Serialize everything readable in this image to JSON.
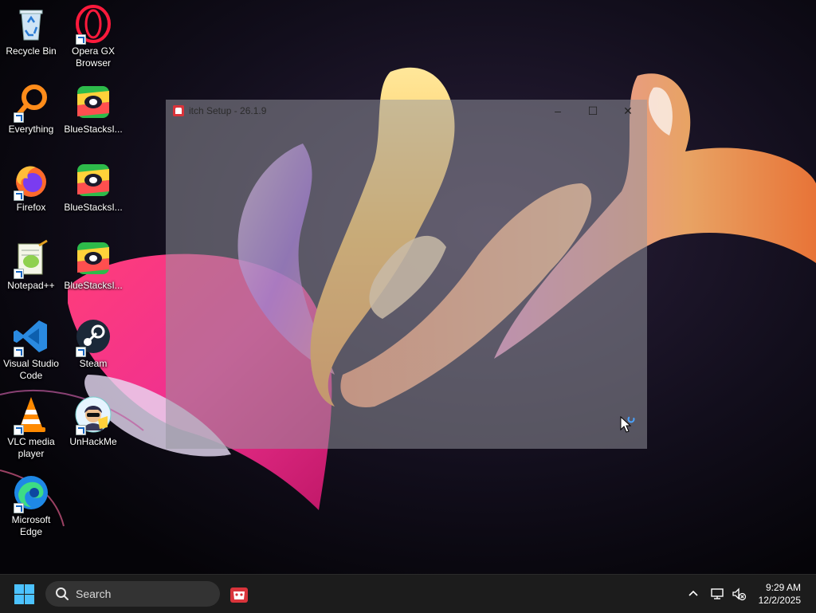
{
  "desktop": {
    "icons": [
      {
        "label": "Recycle Bin",
        "icon": "recycle-bin-icon"
      },
      {
        "label": "Opera GX Browser",
        "icon": "opera-gx-icon"
      },
      {
        "label": "Everything",
        "icon": "everything-search-icon"
      },
      {
        "label": "BlueStacksI...",
        "icon": "bluestacks-icon"
      },
      {
        "label": "Firefox",
        "icon": "firefox-icon"
      },
      {
        "label": "BlueStacksI...",
        "icon": "bluestacks-icon"
      },
      {
        "label": "Notepad++",
        "icon": "notepadpp-icon"
      },
      {
        "label": "BlueStacksI...",
        "icon": "bluestacks-icon"
      },
      {
        "label": "Visual Studio Code",
        "icon": "vscode-icon"
      },
      {
        "label": "Steam",
        "icon": "steam-icon"
      },
      {
        "label": "VLC media player",
        "icon": "vlc-icon"
      },
      {
        "label": "UnHackMe",
        "icon": "unhackme-icon"
      },
      {
        "label": "Microsoft Edge",
        "icon": "edge-icon"
      }
    ]
  },
  "setup_window": {
    "title": "itch Setup - 26.1.9",
    "icon": "itch-icon",
    "controls": {
      "minimize": "–",
      "maximize": "☐",
      "close": "✕"
    }
  },
  "taskbar": {
    "start_icon": "windows-start-icon",
    "search_placeholder": "Search",
    "pinned": [
      {
        "icon": "itch-icon",
        "name": "itch"
      }
    ],
    "tray": {
      "chevron": "^",
      "network_icon": "network-icon",
      "volume_icon": "volume-muted-icon"
    },
    "clock": {
      "time": "9:29 AM",
      "date": "12/2/2025"
    }
  },
  "colors": {
    "taskbar_bg": "#1c1c1c",
    "windows_blue": "#4cc2ff",
    "itch_red": "#d9343b"
  }
}
